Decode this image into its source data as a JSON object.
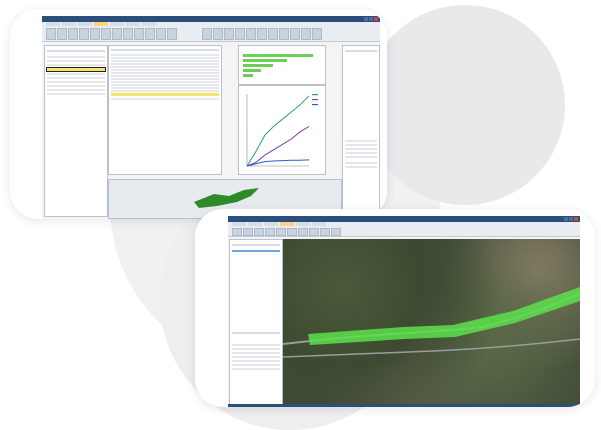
{
  "card1": {
    "window_title": "",
    "ribbon_tabs": [
      "",
      "",
      "",
      "",
      "",
      "",
      ""
    ],
    "chart_data": {
      "type": "line",
      "title": "",
      "xlabel": "",
      "ylabel": "",
      "legend_position": "top-right",
      "series": [
        {
          "color": "#2e9d73",
          "x": [
            0,
            10,
            20,
            30,
            40,
            50,
            60,
            70
          ],
          "values": [
            0,
            40,
            85,
            110,
            130,
            150,
            170,
            195
          ]
        },
        {
          "color": "#7a3fb5",
          "x": [
            0,
            10,
            20,
            30,
            40,
            50,
            60,
            70
          ],
          "values": [
            0,
            10,
            30,
            45,
            60,
            75,
            95,
            110
          ]
        },
        {
          "color": "#2b5cd0",
          "x": [
            0,
            10,
            20,
            30,
            40,
            50,
            60,
            70
          ],
          "values": [
            0,
            6,
            12,
            14,
            15,
            16,
            16,
            17
          ]
        }
      ],
      "xlim": [
        0,
        70
      ],
      "ylim": [
        0,
        200
      ]
    }
  },
  "card2": {
    "window_title": ""
  },
  "colors": {
    "title_bar": "#2b4e7a",
    "highlight_row": "#f5e36a",
    "corridor": "#5ce04b",
    "bar_fill": "#6bcf5a"
  }
}
